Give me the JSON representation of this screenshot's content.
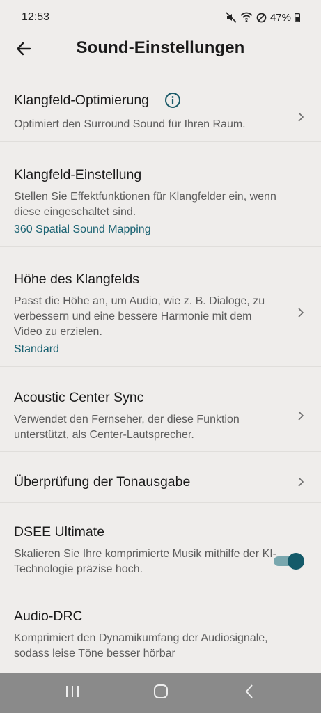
{
  "status_bar": {
    "time": "12:53",
    "battery": "47%",
    "icons": [
      "mute-icon",
      "wifi-icon",
      "dnd-icon",
      "battery-icon"
    ]
  },
  "header": {
    "title": "Sound-Einstellungen",
    "back_icon": "arrow-left-icon"
  },
  "settings": {
    "items": [
      {
        "title": "Klangfeld-Optimierung",
        "desc": "Optimiert den Surround Sound für Ihren Raum.",
        "has_info": true,
        "has_chevron": true
      },
      {
        "title": "Klangfeld-Einstellung",
        "desc": "Stellen Sie Effektfunktionen für Klangfelder ein, wenn diese eingeschaltet sind.",
        "value": "360 Spatial Sound Mapping",
        "has_chevron": false
      },
      {
        "title": "Höhe des Klangfelds",
        "desc": "Passt die Höhe an, um Audio, wie z. B. Dialoge, zu verbessern und eine bessere Harmonie mit dem Video zu erzielen.",
        "value": "Standard",
        "has_chevron": true
      },
      {
        "title": "Acoustic Center Sync",
        "desc": "Verwendet den Fernseher, der diese Funktion unterstützt, als Center-Lautsprecher.",
        "has_chevron": true
      },
      {
        "title": "Überprüfung der Tonausgabe",
        "has_chevron": true
      },
      {
        "title": "DSEE Ultimate",
        "desc": "Skalieren Sie Ihre komprimierte Musik mithilfe der KI-Technologie präzise hoch.",
        "toggle_on": true
      },
      {
        "title": "Audio-DRC",
        "desc": "Komprimiert den Dynamikumfang der Audiosignale, sodass leise Töne besser hörbar"
      }
    ]
  },
  "colors": {
    "background": "#efedeb",
    "accent": "#1a6272",
    "toggle_thumb": "#145a69",
    "toggle_track": "#79a7ae",
    "nav_bar": "#8a8a8a"
  },
  "nav_bar": {
    "icons": [
      "recents-icon",
      "home-icon",
      "back-nav-icon"
    ]
  }
}
